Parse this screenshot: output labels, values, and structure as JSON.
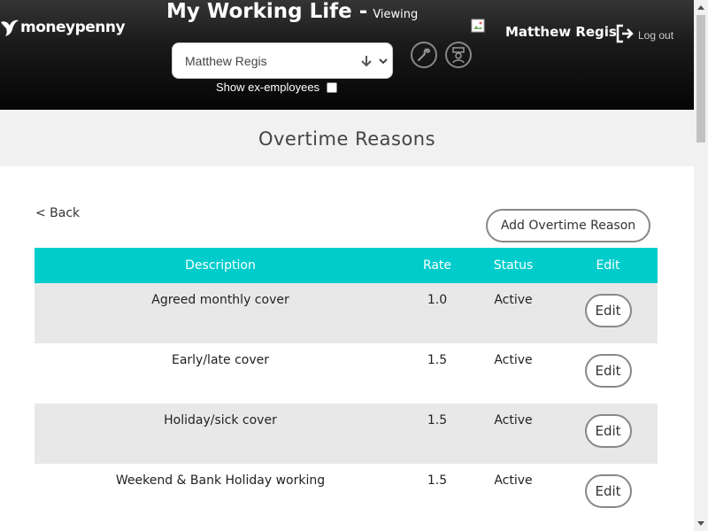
{
  "header": {
    "logo_text": "moneypenny",
    "app_title": "My Working Life -",
    "viewing_label": "Viewing",
    "employee_select_value": "Matthew Regis",
    "show_ex_label": "Show ex-employees",
    "show_ex_checked": false,
    "user_name": "Matthew Regis",
    "logout_label": "Log out",
    "tool_icons": [
      "wrench-icon",
      "org-chart-icon"
    ]
  },
  "page": {
    "title": "Overtime Reasons",
    "back_label": "< Back",
    "add_button_label": "Add Overtime Reason"
  },
  "table": {
    "headers": [
      "Description",
      "Rate",
      "Status",
      "Edit"
    ],
    "rows": [
      {
        "description": "Agreed monthly cover",
        "rate": "1.0",
        "status": "Active",
        "edit": "Edit"
      },
      {
        "description": "Early/late cover",
        "rate": "1.5",
        "status": "Active",
        "edit": "Edit"
      },
      {
        "description": "Holiday/sick cover",
        "rate": "1.5",
        "status": "Active",
        "edit": "Edit"
      },
      {
        "description": "Weekend & Bank Holiday working",
        "rate": "1.5",
        "status": "Active",
        "edit": "Edit"
      }
    ]
  },
  "colors": {
    "header_bg": "#1a1a1a",
    "table_header_bg": "#00cccc",
    "row_alt_bg": "#e8e8e8"
  }
}
